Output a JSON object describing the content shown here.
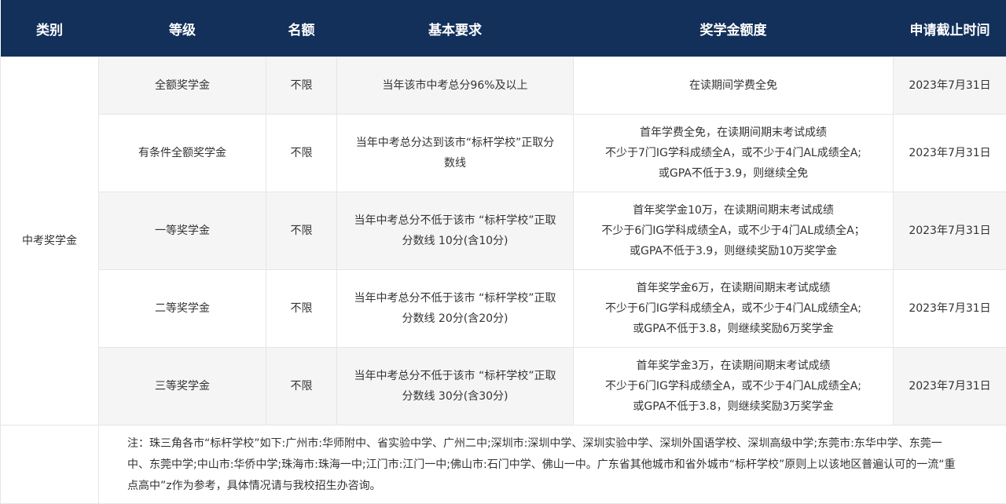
{
  "table": {
    "headers": [
      "类别",
      "等级",
      "名额",
      "基本要求",
      "奖学金额度",
      "申请截止时间"
    ],
    "category": "中考奖学金",
    "rows": [
      {
        "level": "全额奖学金",
        "quota": "不限",
        "requirement": [
          "当年该市中考总分96%及以上"
        ],
        "amount": [
          "在读期间学费全免"
        ],
        "deadline": "2023年7月31日"
      },
      {
        "level": "有条件全额奖学金",
        "quota": "不限",
        "requirement": [
          "当年中考总分达到该市“标杆学校”正取分",
          "数线"
        ],
        "amount": [
          "首年学费全免，在读期间期末考试成绩",
          "不少于7门IG学科成绩全A，或不少于4门AL成绩全A;",
          "或GPA不低于3.9，则继续全免"
        ],
        "deadline": "2023年7月31日"
      },
      {
        "level": "一等奖学金",
        "quota": "不限",
        "requirement": [
          "当年中考总分不低于该市 “标杆学校”正取",
          "分数线 10分(含10分)"
        ],
        "amount": [
          "首年奖学金10万，在读期间期末考试成绩",
          "不少于6门IG学科成绩全A，或不少于4门AL成绩全A；",
          "或GPA不低于3.9，则继续奖励10万奖学金"
        ],
        "deadline": "2023年7月31日"
      },
      {
        "level": "二等奖学金",
        "quota": "不限",
        "requirement": [
          "当年中考总分不低于该市 “标杆学校”正取",
          "分数线 20分(含20分)"
        ],
        "amount": [
          "首年奖学金6万，在读期间期末考试成绩",
          "不少于6门IG学科成绩全A，或不少于4门AL成绩全A;",
          "或GPA不低于3.8，则继续奖励6万奖学金"
        ],
        "deadline": "2023年7月31日"
      },
      {
        "level": "三等奖学金",
        "quota": "不限",
        "requirement": [
          "当年中考总分不低于该市 “标杆学校”正取",
          "分数线 30分(含30分)"
        ],
        "amount": [
          "首年奖学金3万，在读期间期末考试成绩",
          "不少于6门IG学科成绩全A，或不少于4门AL成绩全A;",
          "或GPA不低于3.8，则继续奖励3万奖学金"
        ],
        "deadline": "2023年7月31日"
      }
    ],
    "note": [
      "注：珠三角各市“标杆学校”如下:广州市:华师附中、省实验中学、广州二中;深圳市:深圳中学、深圳实验中学、深圳外国语学校、深圳高级中学;东莞市:东华中学、东莞一",
      "中、东莞中学;中山市:华侨中学;珠海市:珠海一中;江门市:江门一中;佛山市:石门中学、佛山一中。广东省其他城市和省外城市“标杆学校”原则上以该地区普遍认可的一流“重",
      "点高中”z作为参考，具体情况请与我校招生办咨询。"
    ]
  },
  "colors": {
    "header_bg": "#13305a",
    "header_text": "#ffffff",
    "row_shade": "#f5f5f5",
    "border": "#e6e6e6"
  }
}
